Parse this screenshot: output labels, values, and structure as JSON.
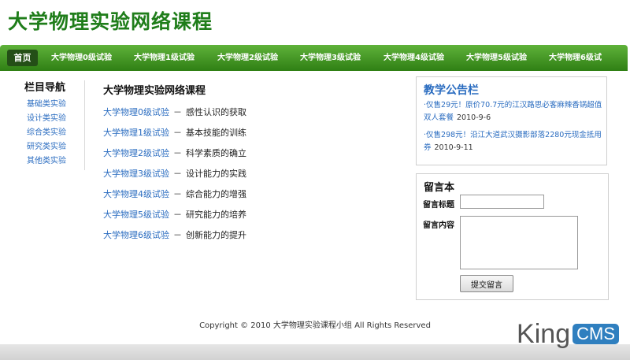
{
  "site": {
    "title": "大学物理实验网络课程"
  },
  "nav": {
    "items": [
      "首页",
      "大学物理0级试验",
      "大学物理1级试验",
      "大学物理2级试验",
      "大学物理3级试验",
      "大学物理4级试验",
      "大学物理5级试验",
      "大学物理6级试"
    ]
  },
  "sidebar": {
    "title": "栏目导航",
    "items": [
      "基础类实验",
      "设计类实验",
      "综合类实验",
      "研究类实验",
      "其他类实验"
    ]
  },
  "main": {
    "title": "大学物理实验网络课程",
    "dash": "－",
    "items": [
      {
        "link": "大学物理0级试验",
        "desc": "感性认识的获取"
      },
      {
        "link": "大学物理1级试验",
        "desc": "基本技能的训练"
      },
      {
        "link": "大学物理2级试验",
        "desc": "科学素质的确立"
      },
      {
        "link": "大学物理3级试验",
        "desc": "设计能力的实践"
      },
      {
        "link": "大学物理4级试验",
        "desc": "综合能力的增强"
      },
      {
        "link": "大学物理5级试验",
        "desc": "研究能力的培养"
      },
      {
        "link": "大学物理6级试验",
        "desc": "创新能力的提升"
      }
    ]
  },
  "notices": {
    "title": "教学公告栏",
    "items": [
      {
        "text": "·仅售29元！原价70.7元的江汉路思必客麻辣香锅超值双人套餐",
        "date": "2010-9-6"
      },
      {
        "text": "·仅售298元！沿江大道武汉摄影部落2280元现金抵用券",
        "date": "2010-9-11"
      }
    ]
  },
  "guestbook": {
    "title": "留言本",
    "title_label": "留言标题",
    "content_label": "留言内容",
    "title_value": "",
    "content_value": "",
    "submit_label": "提交留言"
  },
  "footer": {
    "copyright": "Copyright © 2010 大学物理实验课程小组  All Rights Reserved"
  },
  "watermark": {
    "king": "King",
    "cms": "CMS"
  },
  "colors": {
    "nav_green": "#2f7f14",
    "title_green": "#1f7d1a",
    "link_blue": "#2a6cc0"
  }
}
